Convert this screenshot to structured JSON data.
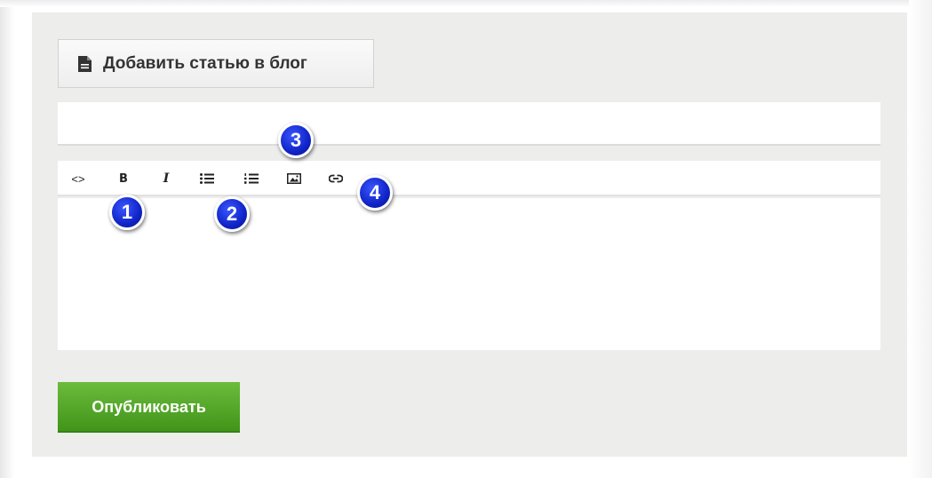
{
  "header": {
    "add_article_label": "Добавить статью в блог",
    "add_article_icon": "document-icon"
  },
  "title_input": {
    "value": "",
    "placeholder": ""
  },
  "toolbar": {
    "items": [
      {
        "name": "code",
        "glyph": "<>",
        "icon": "code-icon"
      },
      {
        "name": "bold",
        "glyph": "B",
        "icon": "bold-icon"
      },
      {
        "name": "italic",
        "glyph": "I",
        "icon": "italic-icon"
      },
      {
        "name": "unordered-list",
        "icon": "bullet-list-icon"
      },
      {
        "name": "ordered-list",
        "icon": "numbered-list-icon"
      },
      {
        "name": "image",
        "icon": "image-icon"
      },
      {
        "name": "link",
        "icon": "link-icon"
      }
    ]
  },
  "editor": {
    "value": ""
  },
  "annotations": {
    "badges": [
      "1",
      "2",
      "3",
      "4"
    ],
    "color": "#1024c8"
  },
  "footer": {
    "publish_label": "Опубликовать",
    "publish_color": "#4fa424"
  }
}
